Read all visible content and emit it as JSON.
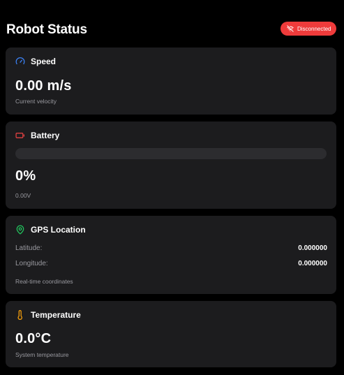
{
  "header": {
    "title": "Robot Status",
    "connection_status": "Disconnected"
  },
  "colors": {
    "background": "#000000",
    "card": "#1c1c1e",
    "status_disconnected": "#ef3b3b",
    "speed_icon": "#3b82f6",
    "battery_icon": "#ef4444",
    "gps_icon": "#22c55e",
    "temperature_icon": "#f59e0b"
  },
  "speed": {
    "label": "Speed",
    "icon": "gauge-icon",
    "value": "0.00 m/s",
    "caption": "Current velocity"
  },
  "battery": {
    "label": "Battery",
    "icon": "battery-icon",
    "percent_value": 0,
    "value": "0%",
    "voltage": "0.00V"
  },
  "gps": {
    "label": "GPS Location",
    "icon": "map-pin-icon",
    "latitude_label": "Latitude:",
    "latitude_value": "0.000000",
    "longitude_label": "Longitude:",
    "longitude_value": "0.000000",
    "caption": "Real-time coordinates"
  },
  "temperature": {
    "label": "Temperature",
    "icon": "thermometer-icon",
    "value": "0.0°C",
    "caption": "System temperature"
  }
}
